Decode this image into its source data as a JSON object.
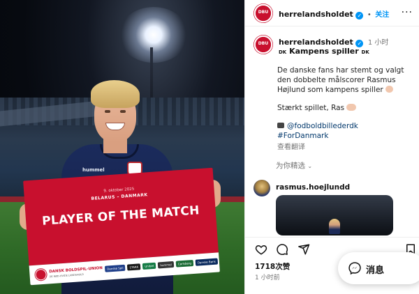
{
  "photo": {
    "sign": {
      "date": "9. oktober 2025",
      "teams": "BELARUS – DANMARK",
      "title": "PLAYER OF THE MATCH",
      "union_name": "DANSK BOLDSPIL-UNION",
      "union_tagline": "DE RØD-HVIDE LANDSHOLD",
      "sponsors": [
        {
          "label": "Danske Spil",
          "color": "#1f3f8a"
        },
        {
          "label": "STARK",
          "color": "#1a1a1a"
        },
        {
          "label": "Unibet",
          "color": "#147b45"
        },
        {
          "label": "hummel",
          "color": "#333333"
        },
        {
          "label": "Carlsberg",
          "color": "#1b6b35"
        },
        {
          "label": "Danske Bank",
          "color": "#0a2a5e"
        }
      ]
    },
    "shirt_brand": "hummel"
  },
  "header": {
    "username": "herrelandsholdet",
    "separator": "•",
    "follow_label": "关注",
    "more_label": "···"
  },
  "caption": {
    "username": "herrelandsholdet",
    "time": "1 小时",
    "title_flag_left": "DK",
    "title": "Kampens spiller",
    "title_flag_right": "DK",
    "paragraph1": "De danske fans har stemt og valgt den dobbelte målscorer Rasmus Højlund som kampens spiller",
    "paragraph2": "Stærkt spillet, Ras",
    "photographer": "@fodboldbillederdk",
    "hashtag": "#ForDanmark",
    "translate_label": "查看翻译",
    "replies_label": "为你精选"
  },
  "comment": {
    "username": "rasmus.hoejlundd"
  },
  "footer": {
    "likes": "1718次赞",
    "time_ago": "1 小时前"
  },
  "message_button": {
    "label": "消息"
  },
  "colors": {
    "dbu_red": "#c8102e",
    "instagram_blue": "#0095f6",
    "hashtag_blue": "#00376b",
    "muted_text": "#737373"
  },
  "icons": [
    "verified-badge-icon",
    "more-options-icon",
    "heart-icon",
    "comment-icon",
    "share-icon",
    "bookmark-icon",
    "messenger-icon",
    "camera-emoji-icon",
    "clapping-emoji-icon",
    "raised-hands-emoji-icon",
    "chevron-down-icon"
  ]
}
